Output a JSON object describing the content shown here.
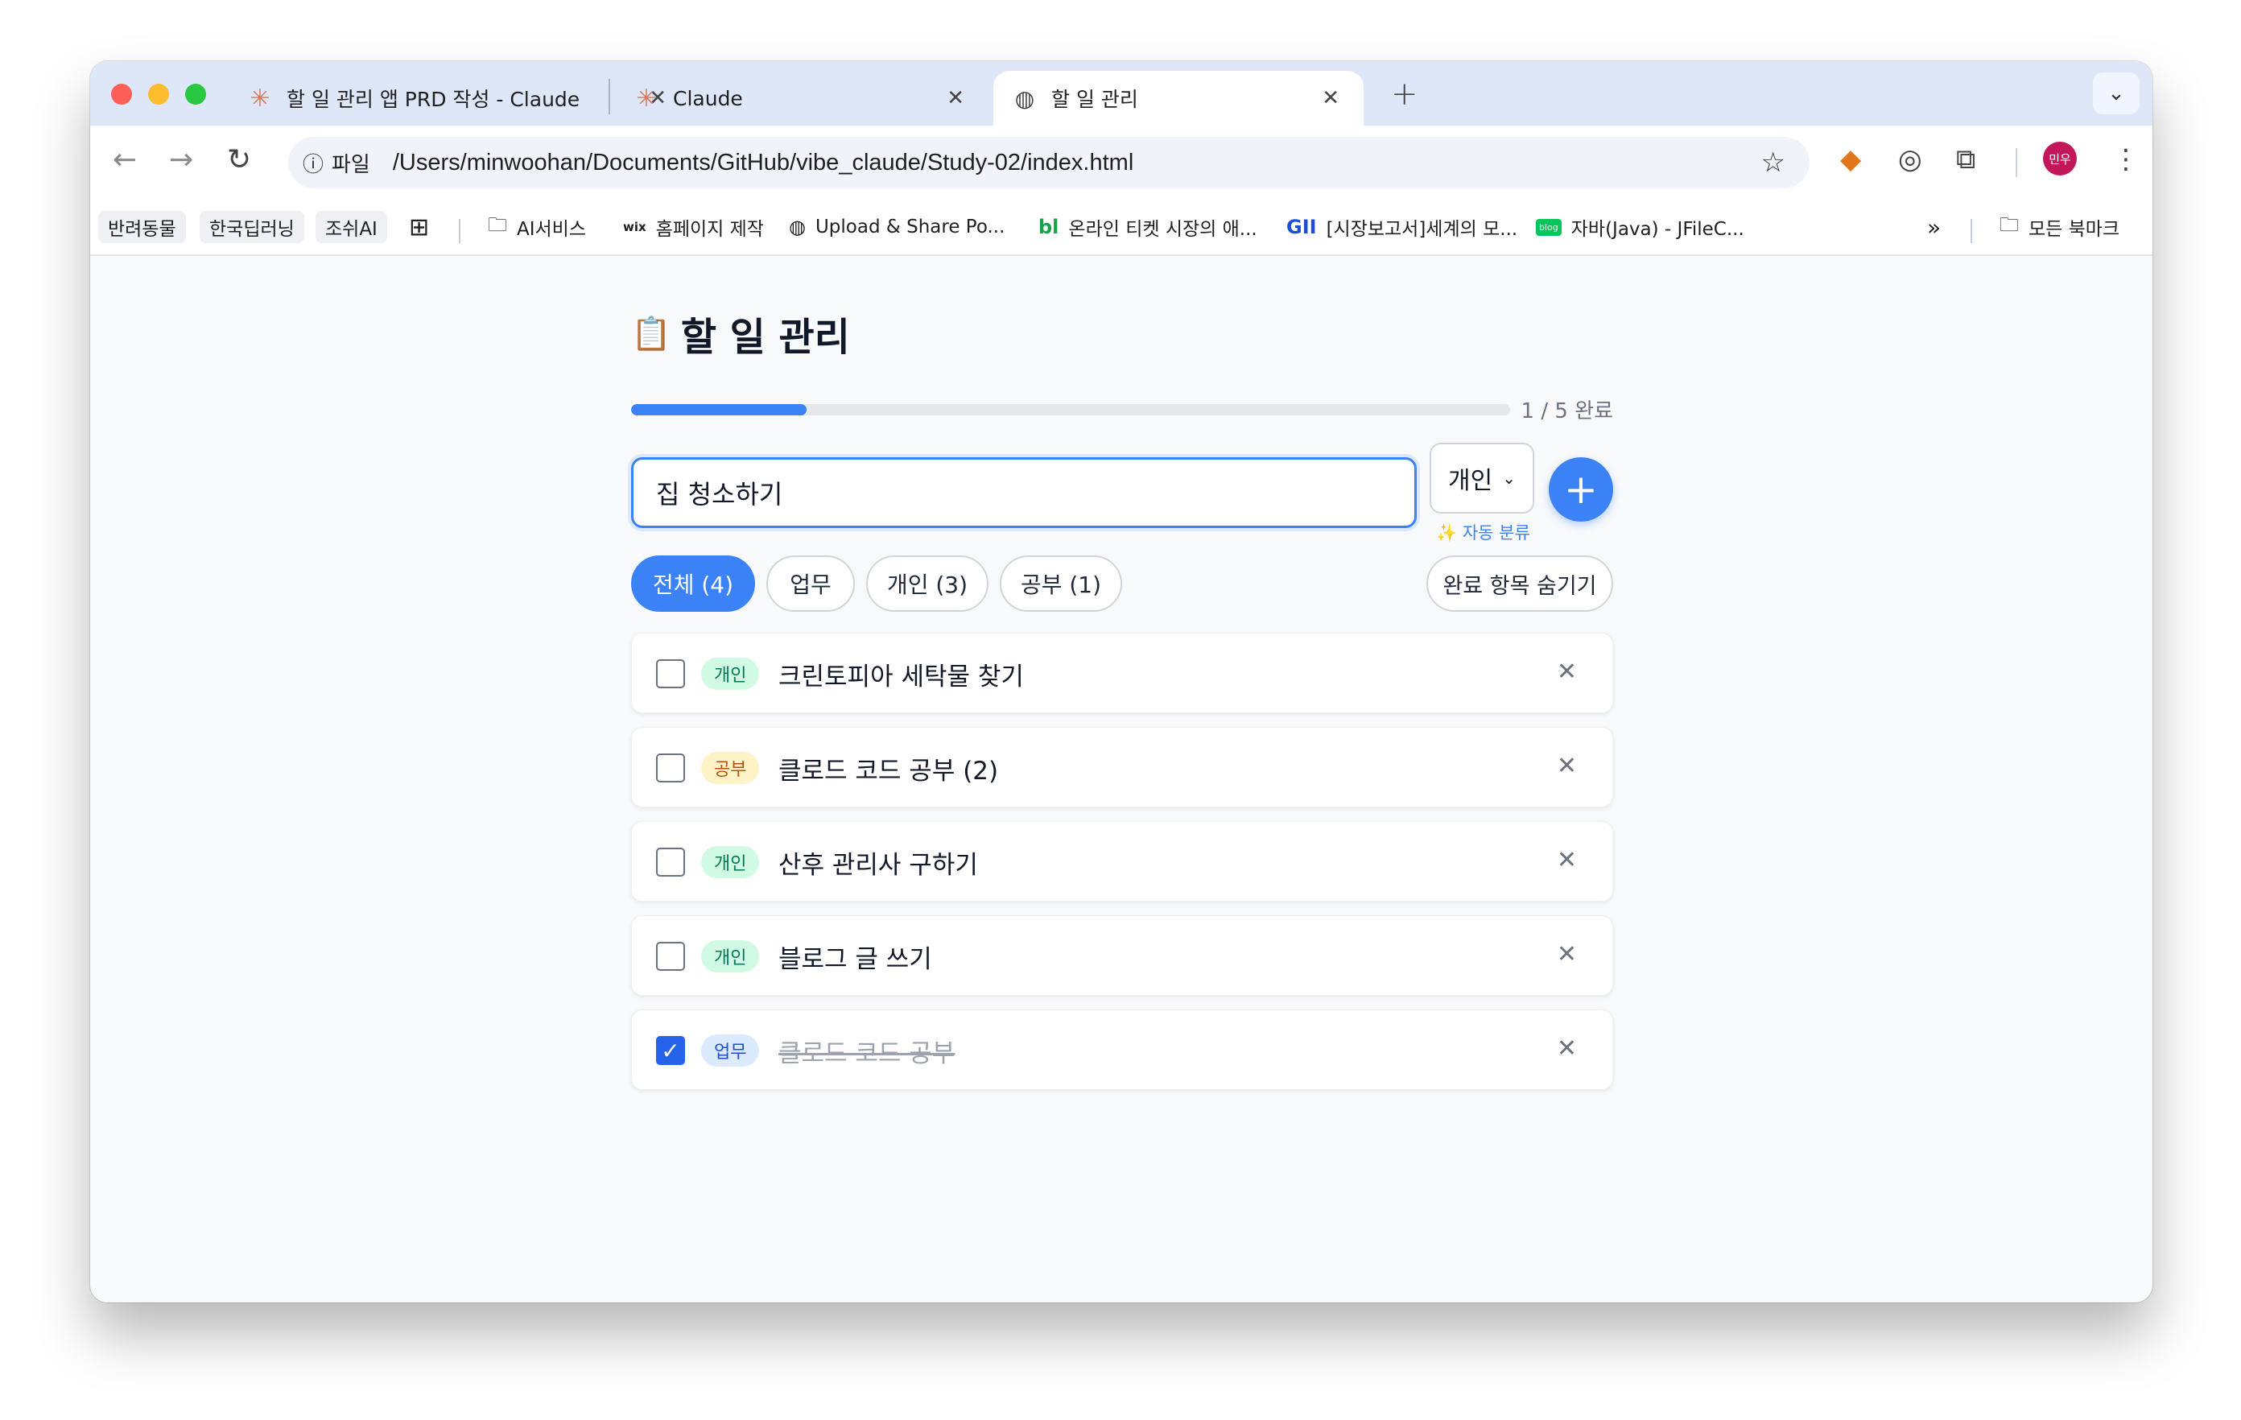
{
  "browser": {
    "tabs": [
      {
        "title": "할 일 관리 앱 PRD 작성 - Claude",
        "icon": "claude-icon"
      },
      {
        "title": "Claude",
        "icon": "claude-icon"
      },
      {
        "title": "할 일 관리",
        "icon": "globe-icon",
        "active": true
      }
    ],
    "address": {
      "chip": "파일",
      "url": "/Users/minwoohan/Documents/GitHub/vibe_claude/Study-02/index.html"
    },
    "profile_initials": "민우",
    "bookmarks": [
      {
        "label": "반려동물",
        "type": "chip"
      },
      {
        "label": "한국딥러닝",
        "type": "chip"
      },
      {
        "label": "조쉬AI",
        "type": "chip"
      },
      {
        "label": "AI서비스",
        "type": "folder"
      },
      {
        "label": "홈페이지 제작",
        "type": "link",
        "icon_text": "wix"
      },
      {
        "label": "Upload & Share Po...",
        "type": "link"
      },
      {
        "label": "온라인 티켓 시장의 애...",
        "type": "link",
        "icon_text": "bl"
      },
      {
        "label": "[시장보고서]세계의 모...",
        "type": "link",
        "icon_text": "GII"
      },
      {
        "label": "자바(Java) - JFileC...",
        "type": "link",
        "icon_text": "blog"
      }
    ],
    "all_bookmarks": "모든 북마크"
  },
  "app": {
    "title": "할 일 관리",
    "progress": {
      "completed": 1,
      "total": 5,
      "fraction": 0.2,
      "label": "1 / 5 완료"
    },
    "input": {
      "value": "집 청소하기"
    },
    "category_select": {
      "value": "개인"
    },
    "auto_classify": "✨ 자동 분류",
    "add_button": "+",
    "filters": [
      {
        "label": "전체 (4)",
        "active": true
      },
      {
        "label": "업무",
        "active": false
      },
      {
        "label": "개인 (3)",
        "active": false
      },
      {
        "label": "공부 (1)",
        "active": false
      }
    ],
    "hide_completed": "완료 항목 숨기기",
    "todos": [
      {
        "category": "개인",
        "text": "크린토피아 세탁물 찾기",
        "done": false
      },
      {
        "category": "공부",
        "text": "클로드 코드 공부 (2)",
        "done": false
      },
      {
        "category": "개인",
        "text": "산후 관리사 구하기",
        "done": false
      },
      {
        "category": "개인",
        "text": "블로그 글 쓰기",
        "done": false
      },
      {
        "category": "업무",
        "text": "클로드 코드 공부",
        "done": true
      }
    ]
  },
  "colors": {
    "accent": "#3b82f6",
    "personal_badge": "#d1fae5",
    "study_badge": "#fef3c7",
    "work_badge": "#dbeafe"
  }
}
